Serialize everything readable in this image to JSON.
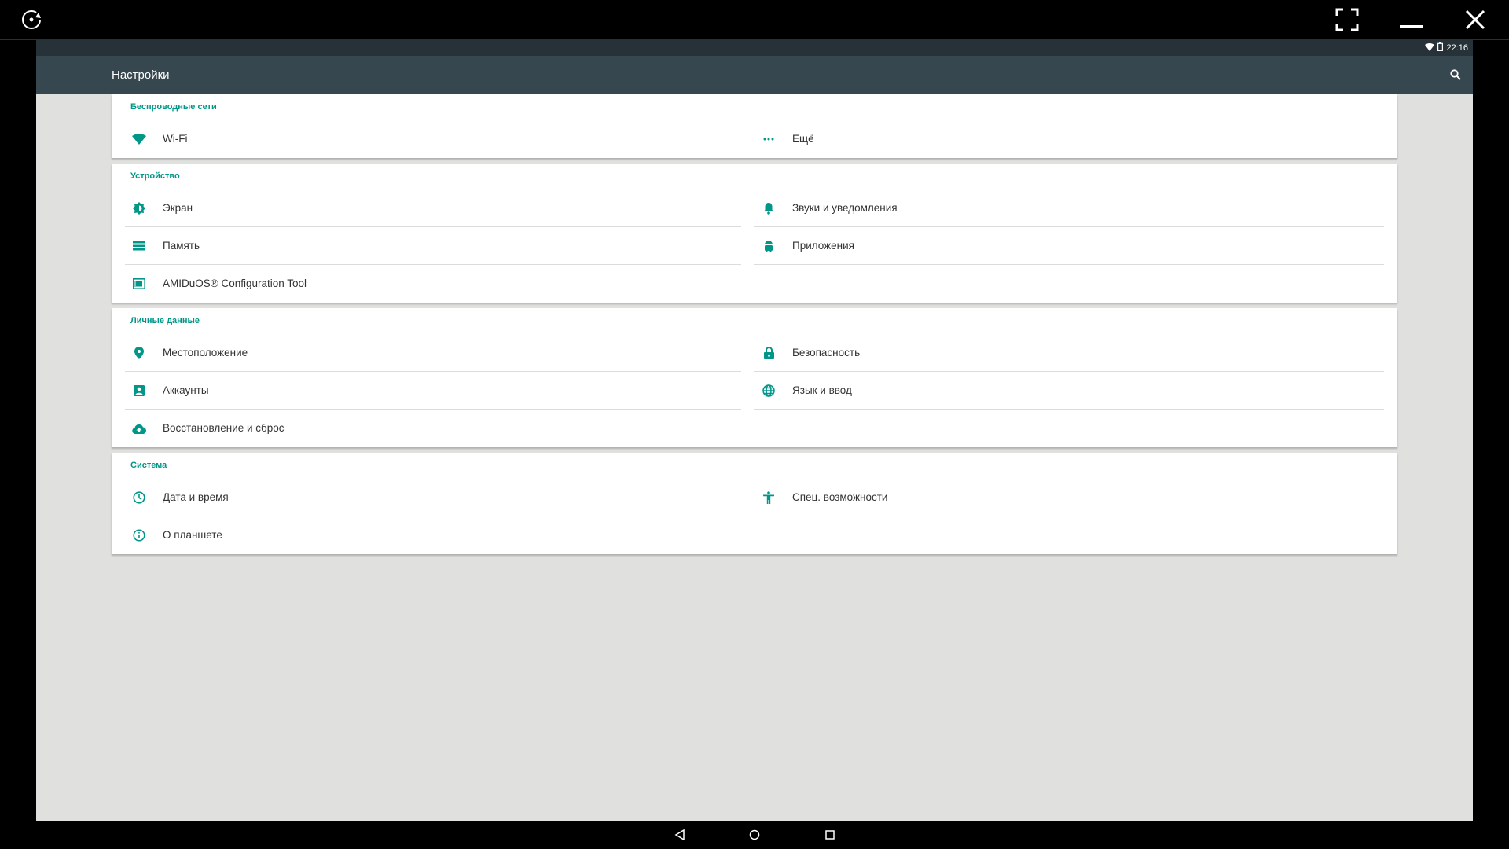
{
  "window": {
    "icons": {
      "rotate": "rotate-icon",
      "fullscreen": "fullscreen-icon",
      "minimize": "minimize-icon",
      "close": "close-icon"
    }
  },
  "statusbar": {
    "time": "22:16",
    "icons": [
      "wifi-icon",
      "battery-icon"
    ]
  },
  "appbar": {
    "title": "Настройки",
    "search_icon": "search-icon"
  },
  "accent": "#009688",
  "sections": [
    {
      "title": "Беспроводные сети",
      "items": [
        {
          "label": "Wi-Fi",
          "icon": "wifi-icon"
        },
        {
          "label": "Ещё",
          "icon": "more-icon"
        }
      ]
    },
    {
      "title": "Устройство",
      "items": [
        {
          "label": "Экран",
          "icon": "brightness-icon"
        },
        {
          "label": "Звуки и уведомления",
          "icon": "bell-icon"
        },
        {
          "label": "Память",
          "icon": "storage-icon"
        },
        {
          "label": "Приложения",
          "icon": "android-icon"
        },
        {
          "label": "AMIDuOS® Configuration Tool",
          "icon": "config-tool-icon"
        }
      ]
    },
    {
      "title": "Личные данные",
      "items": [
        {
          "label": "Местоположение",
          "icon": "location-icon"
        },
        {
          "label": "Безопасность",
          "icon": "lock-icon"
        },
        {
          "label": "Аккаунты",
          "icon": "account-icon"
        },
        {
          "label": "Язык и ввод",
          "icon": "globe-icon"
        },
        {
          "label": "Восстановление и сброс",
          "icon": "cloud-upload-icon"
        }
      ]
    },
    {
      "title": "Система",
      "items": [
        {
          "label": "Дата и время",
          "icon": "clock-icon"
        },
        {
          "label": "Спец. возможности",
          "icon": "accessibility-icon"
        },
        {
          "label": "О планшете",
          "icon": "info-icon"
        }
      ]
    }
  ],
  "navbar": {
    "icons": [
      "back-icon",
      "home-icon",
      "recents-icon"
    ]
  }
}
